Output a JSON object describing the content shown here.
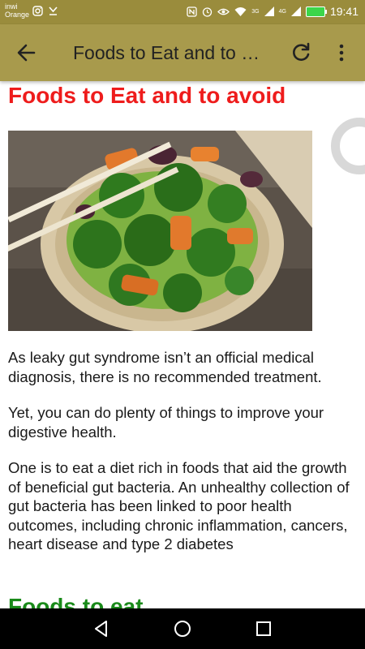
{
  "status_bar": {
    "carrier_line1": "inwi",
    "carrier_line2": "Orange",
    "signal_4g": "4G",
    "signal_3g": "3G",
    "time": "19:41"
  },
  "app_bar": {
    "title": "Foods to Eat and to avoid",
    "icons": [
      "arrow-back-icon",
      "refresh-icon",
      "more-vert-icon"
    ],
    "background": "#a89a4c"
  },
  "article": {
    "heading": "Foods to Eat and to avoid",
    "heading_color": "#ee1c1c",
    "paragraphs": [
      "As leaky gut syndrome isn’t an official medical diagnosis, there is no recommended treatment.",
      "Yet, you can do plenty of things to improve your digestive health.",
      "One is to eat a diet rich in foods that aid the growth of beneficial gut bacteria. An unhealthy collection of gut bacteria has been linked to poor health outcomes, including chronic inflammation, cancers, heart disease and type 2 diabetes"
    ],
    "section_heading": "Foods to eat",
    "section_heading_color": "#1a8a1a"
  },
  "nav_bar": {
    "icons": [
      "nav-back-icon",
      "nav-home-icon",
      "nav-recent-icon"
    ]
  }
}
